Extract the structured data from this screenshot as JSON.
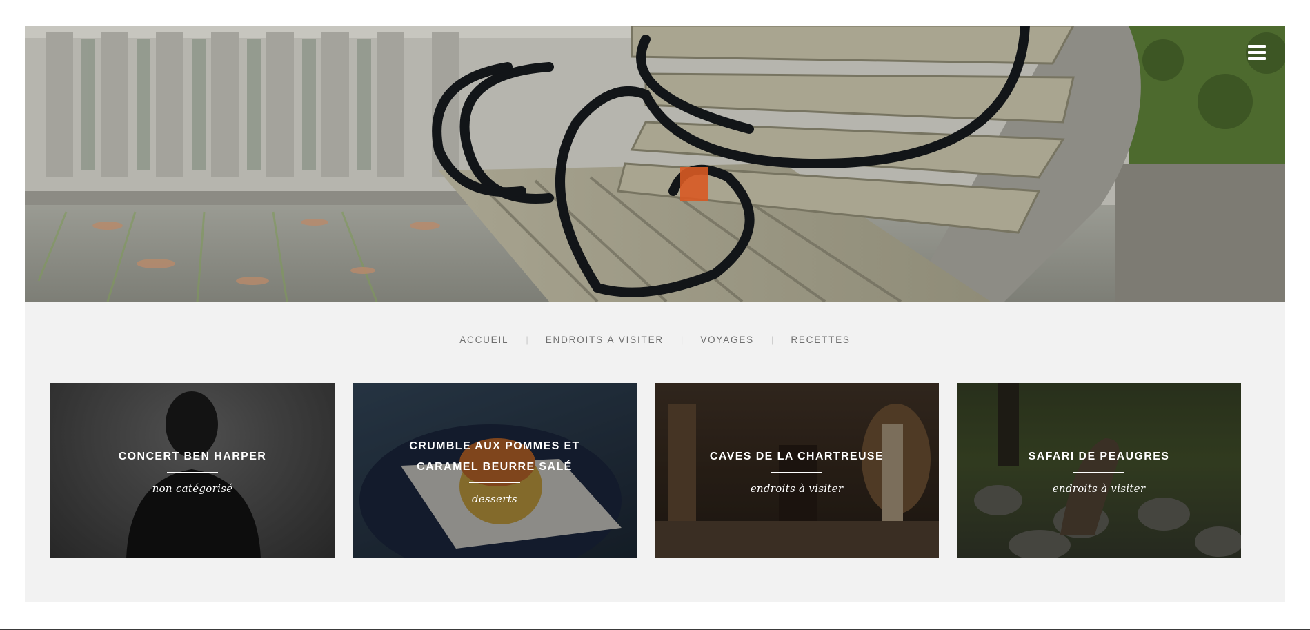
{
  "header": {
    "menu_icon": "hamburger-menu-icon"
  },
  "nav": {
    "items": [
      {
        "label": "ACCUEIL"
      },
      {
        "label": "ENDROITS À VISITER"
      },
      {
        "label": "VOYAGES"
      },
      {
        "label": "RECETTES"
      }
    ],
    "separator": "|"
  },
  "cards": [
    {
      "title": "CONCERT BEN HARPER",
      "category": "non catégorisé"
    },
    {
      "title": "CRUMBLE AUX POMMES ET\nCARAMEL BEURRE SALÉ",
      "category": "desserts"
    },
    {
      "title": "CAVES DE LA CHARTREUSE",
      "category": "endroits à visiter"
    },
    {
      "title": "SAFARI DE PEAUGRES",
      "category": "endroits à visiter"
    }
  ]
}
